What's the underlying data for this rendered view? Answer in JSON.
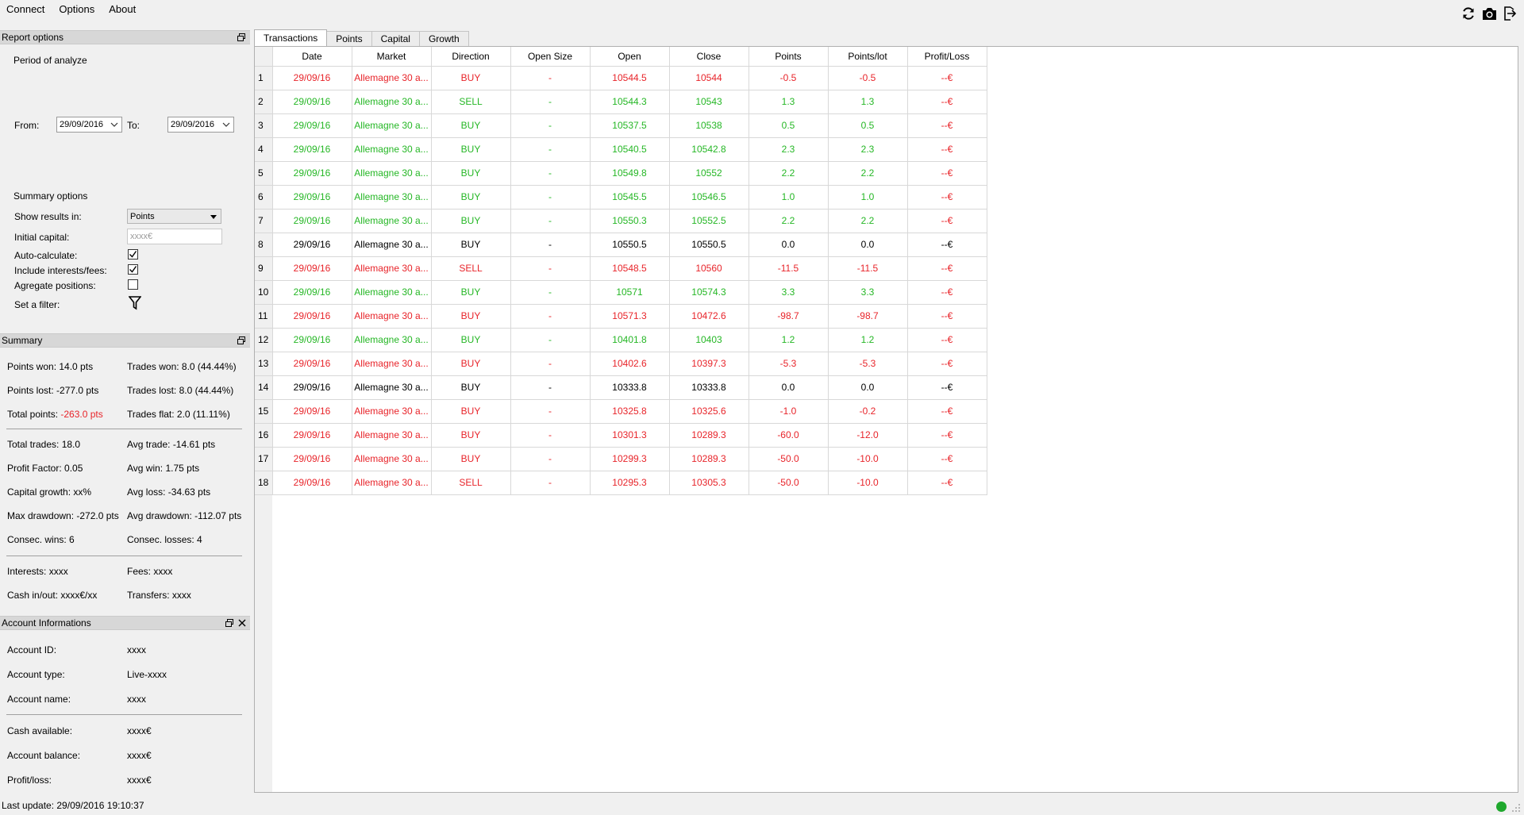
{
  "menu": {
    "connect": "Connect",
    "options": "Options",
    "about": "About"
  },
  "toolbar": {
    "icons": [
      "refresh-icon",
      "camera-icon",
      "logout-icon"
    ]
  },
  "report": {
    "title": "Report options",
    "period_label": "Period of analyze",
    "from_label": "From:",
    "from_value": "29/09/2016",
    "to_label": "To:",
    "to_value": "29/09/2016",
    "summary_options_label": "Summary options",
    "show_results_label": "Show results in:",
    "show_results_value": "Points",
    "initial_capital_label": "Initial capital:",
    "initial_capital_placeholder": "xxxx€",
    "auto_calc_label": "Auto-calculate:",
    "auto_calc_checked": true,
    "include_fees_label": "Include interests/fees:",
    "include_fees_checked": true,
    "aggregate_label": "Agregate positions:",
    "aggregate_checked": false,
    "filter_label": "Set a filter:"
  },
  "summary": {
    "title": "Summary",
    "points_won": "Points won: 14.0 pts",
    "trades_won": "Trades won: 8.0 (44.44%)",
    "points_lost": "Points lost: -277.0 pts",
    "trades_lost": "Trades lost: 8.0 (44.44%)",
    "total_points_label": "Total points:",
    "total_points_value": "-263.0 pts",
    "trades_flat": "Trades flat: 2.0 (11.11%)",
    "total_trades": "Total trades: 18.0",
    "avg_trade": "Avg trade: -14.61 pts",
    "profit_factor": "Profit Factor: 0.05",
    "avg_win": "Avg win: 1.75 pts",
    "capital_growth": "Capital growth: xx%",
    "avg_loss": "Avg loss: -34.63 pts",
    "max_drawdown": "Max drawdown: -272.0 pts",
    "avg_drawdown": "Avg drawdown: -112.07 pts",
    "consec_wins": "Consec. wins: 6",
    "consec_losses": "Consec. losses: 4",
    "interests": "Interests: xxxx",
    "fees": "Fees: xxxx",
    "cash_inout": "Cash in/out: xxxx€/xx",
    "transfers": "Transfers: xxxx"
  },
  "account": {
    "title": "Account Informations",
    "id_label": "Account ID:",
    "id_value": "xxxx",
    "type_label": "Account type:",
    "type_value": "Live-xxxx",
    "name_label": "Account name:",
    "name_value": "xxxx",
    "cash_label": "Cash available:",
    "cash_value": "xxxx€",
    "balance_label": "Account balance:",
    "balance_value": "xxxx€",
    "pl_label": "Profit/loss:",
    "pl_value": "xxxx€"
  },
  "tabs": [
    "Transactions",
    "Points",
    "Capital",
    "Growth"
  ],
  "colors": {
    "loss": "#e8242a",
    "win": "#25b725",
    "flat": "#000000"
  },
  "table": {
    "columns": [
      "Date",
      "Market",
      "Direction",
      "Open Size",
      "Open",
      "Close",
      "Points",
      "Points/lot",
      "Profit/Loss"
    ],
    "rows": [
      {
        "n": "1",
        "date": "29/09/16",
        "market": "Allemagne 30 a...",
        "dir": "BUY",
        "size": "-",
        "open": "10544.5",
        "close": "10544",
        "points": "-0.5",
        "ppl": "-0.5",
        "pl": "--€",
        "status": "loss"
      },
      {
        "n": "2",
        "date": "29/09/16",
        "market": "Allemagne 30 a...",
        "dir": "SELL",
        "size": "-",
        "open": "10544.3",
        "close": "10543",
        "points": "1.3",
        "ppl": "1.3",
        "pl": "--€",
        "status": "win"
      },
      {
        "n": "3",
        "date": "29/09/16",
        "market": "Allemagne 30 a...",
        "dir": "BUY",
        "size": "-",
        "open": "10537.5",
        "close": "10538",
        "points": "0.5",
        "ppl": "0.5",
        "pl": "--€",
        "status": "win"
      },
      {
        "n": "4",
        "date": "29/09/16",
        "market": "Allemagne 30 a...",
        "dir": "BUY",
        "size": "-",
        "open": "10540.5",
        "close": "10542.8",
        "points": "2.3",
        "ppl": "2.3",
        "pl": "--€",
        "status": "win"
      },
      {
        "n": "5",
        "date": "29/09/16",
        "market": "Allemagne 30 a...",
        "dir": "BUY",
        "size": "-",
        "open": "10549.8",
        "close": "10552",
        "points": "2.2",
        "ppl": "2.2",
        "pl": "--€",
        "status": "win"
      },
      {
        "n": "6",
        "date": "29/09/16",
        "market": "Allemagne 30 a...",
        "dir": "BUY",
        "size": "-",
        "open": "10545.5",
        "close": "10546.5",
        "points": "1.0",
        "ppl": "1.0",
        "pl": "--€",
        "status": "win"
      },
      {
        "n": "7",
        "date": "29/09/16",
        "market": "Allemagne 30 a...",
        "dir": "BUY",
        "size": "-",
        "open": "10550.3",
        "close": "10552.5",
        "points": "2.2",
        "ppl": "2.2",
        "pl": "--€",
        "status": "win"
      },
      {
        "n": "8",
        "date": "29/09/16",
        "market": "Allemagne 30 a...",
        "dir": "BUY",
        "size": "-",
        "open": "10550.5",
        "close": "10550.5",
        "points": "0.0",
        "ppl": "0.0",
        "pl": "--€",
        "status": "flat"
      },
      {
        "n": "9",
        "date": "29/09/16",
        "market": "Allemagne 30 a...",
        "dir": "SELL",
        "size": "-",
        "open": "10548.5",
        "close": "10560",
        "points": "-11.5",
        "ppl": "-11.5",
        "pl": "--€",
        "status": "loss"
      },
      {
        "n": "10",
        "date": "29/09/16",
        "market": "Allemagne 30 a...",
        "dir": "BUY",
        "size": "-",
        "open": "10571",
        "close": "10574.3",
        "points": "3.3",
        "ppl": "3.3",
        "pl": "--€",
        "status": "win"
      },
      {
        "n": "11",
        "date": "29/09/16",
        "market": "Allemagne 30 a...",
        "dir": "BUY",
        "size": "-",
        "open": "10571.3",
        "close": "10472.6",
        "points": "-98.7",
        "ppl": "-98.7",
        "pl": "--€",
        "status": "loss"
      },
      {
        "n": "12",
        "date": "29/09/16",
        "market": "Allemagne 30 a...",
        "dir": "BUY",
        "size": "-",
        "open": "10401.8",
        "close": "10403",
        "points": "1.2",
        "ppl": "1.2",
        "pl": "--€",
        "status": "win"
      },
      {
        "n": "13",
        "date": "29/09/16",
        "market": "Allemagne 30 a...",
        "dir": "BUY",
        "size": "-",
        "open": "10402.6",
        "close": "10397.3",
        "points": "-5.3",
        "ppl": "-5.3",
        "pl": "--€",
        "status": "loss"
      },
      {
        "n": "14",
        "date": "29/09/16",
        "market": "Allemagne 30 a...",
        "dir": "BUY",
        "size": "-",
        "open": "10333.8",
        "close": "10333.8",
        "points": "0.0",
        "ppl": "0.0",
        "pl": "--€",
        "status": "flat"
      },
      {
        "n": "15",
        "date": "29/09/16",
        "market": "Allemagne 30 a...",
        "dir": "BUY",
        "size": "-",
        "open": "10325.8",
        "close": "10325.6",
        "points": "-1.0",
        "ppl": "-0.2",
        "pl": "--€",
        "status": "loss"
      },
      {
        "n": "16",
        "date": "29/09/16",
        "market": "Allemagne 30 a...",
        "dir": "BUY",
        "size": "-",
        "open": "10301.3",
        "close": "10289.3",
        "points": "-60.0",
        "ppl": "-12.0",
        "pl": "--€",
        "status": "loss"
      },
      {
        "n": "17",
        "date": "29/09/16",
        "market": "Allemagne 30 a...",
        "dir": "BUY",
        "size": "-",
        "open": "10299.3",
        "close": "10289.3",
        "points": "-50.0",
        "ppl": "-10.0",
        "pl": "--€",
        "status": "loss"
      },
      {
        "n": "18",
        "date": "29/09/16",
        "market": "Allemagne 30 a...",
        "dir": "SELL",
        "size": "-",
        "open": "10295.3",
        "close": "10305.3",
        "points": "-50.0",
        "ppl": "-10.0",
        "pl": "--€",
        "status": "loss"
      }
    ]
  },
  "status": {
    "last_update": "Last update: 29/09/2016 19:10:37"
  }
}
